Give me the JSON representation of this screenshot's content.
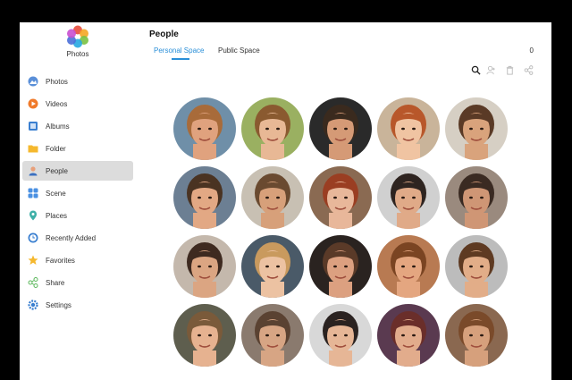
{
  "app": {
    "name": "Photos"
  },
  "sidebar": {
    "items": [
      {
        "label": "Photos",
        "icon": "photos-icon",
        "active": false
      },
      {
        "label": "Videos",
        "icon": "videos-icon",
        "active": false
      },
      {
        "label": "Albums",
        "icon": "albums-icon",
        "active": false
      },
      {
        "label": "Folder",
        "icon": "folder-icon",
        "active": false
      },
      {
        "label": "People",
        "icon": "people-icon",
        "active": true
      },
      {
        "label": "Scene",
        "icon": "scene-icon",
        "active": false
      },
      {
        "label": "Places",
        "icon": "places-icon",
        "active": false
      },
      {
        "label": "Recently Added",
        "icon": "recently-added-icon",
        "active": false
      },
      {
        "label": "Favorites",
        "icon": "favorites-icon",
        "active": false
      },
      {
        "label": "Share",
        "icon": "share-icon",
        "active": false
      },
      {
        "label": "Settings",
        "icon": "settings-icon",
        "active": false
      }
    ]
  },
  "header": {
    "title": "People",
    "tabs": [
      {
        "label": "Personal Space",
        "active": true
      },
      {
        "label": "Public Space",
        "active": false
      }
    ],
    "count": "0",
    "toolbar": [
      "search-icon",
      "person-icon",
      "trash-icon",
      "share-icon"
    ]
  },
  "colors": {
    "accent": "#2a8fd8",
    "active_bg": "#dcdcdc"
  },
  "faces": [
    {
      "name": "face-1",
      "bg": "#6f8fa8",
      "skin": "#e0a27e",
      "hair": "#a86b3a"
    },
    {
      "name": "face-2",
      "bg": "#9ab061",
      "skin": "#e8b895",
      "hair": "#8a5a30"
    },
    {
      "name": "face-3",
      "bg": "#2a2a2a",
      "skin": "#d59a76",
      "hair": "#3a2a1e"
    },
    {
      "name": "face-4",
      "bg": "#c9b49a",
      "skin": "#f0c4a2",
      "hair": "#b8572a"
    },
    {
      "name": "face-5",
      "bg": "#d6cfc4",
      "skin": "#d9a37c",
      "hair": "#5a3a26"
    },
    {
      "name": "face-6",
      "bg": "#6c7f93",
      "skin": "#e2a884",
      "hair": "#4a3322"
    },
    {
      "name": "face-7",
      "bg": "#c8c0b3",
      "skin": "#d7a07a",
      "hair": "#6a4a30"
    },
    {
      "name": "face-8",
      "bg": "#8a6a52",
      "skin": "#e8b79a",
      "hair": "#9a3e22"
    },
    {
      "name": "face-9",
      "bg": "#d0d0d0",
      "skin": "#e0aa88",
      "hair": "#2e2420"
    },
    {
      "name": "face-10",
      "bg": "#9a8a7e",
      "skin": "#cf9675",
      "hair": "#3a2a22"
    },
    {
      "name": "face-11",
      "bg": "#c4b8ac",
      "skin": "#dba582",
      "hair": "#3e2a20"
    },
    {
      "name": "face-12",
      "bg": "#4a5a68",
      "skin": "#ecc2a2",
      "hair": "#c99a5e"
    },
    {
      "name": "face-13",
      "bg": "#2a2320",
      "skin": "#dca080",
      "hair": "#5a3a28"
    },
    {
      "name": "face-14",
      "bg": "#b87a52",
      "skin": "#e4a680",
      "hair": "#7a4422"
    },
    {
      "name": "face-15",
      "bg": "#bcbcbc",
      "skin": "#e2ad88",
      "hair": "#5e3a22"
    },
    {
      "name": "face-16",
      "bg": "#5e5e4e",
      "skin": "#e6b290",
      "hair": "#7a5a3a"
    },
    {
      "name": "face-17",
      "bg": "#8a7a6e",
      "skin": "#d7a584",
      "hair": "#5a4232"
    },
    {
      "name": "face-18",
      "bg": "#d8d8d8",
      "skin": "#e6b696",
      "hair": "#2a2220"
    },
    {
      "name": "face-19",
      "bg": "#5a3a50",
      "skin": "#e2ac8c",
      "hair": "#6a2e2a"
    },
    {
      "name": "face-20",
      "bg": "#8a6850",
      "skin": "#d6a07c",
      "hair": "#7a4a2a"
    }
  ]
}
